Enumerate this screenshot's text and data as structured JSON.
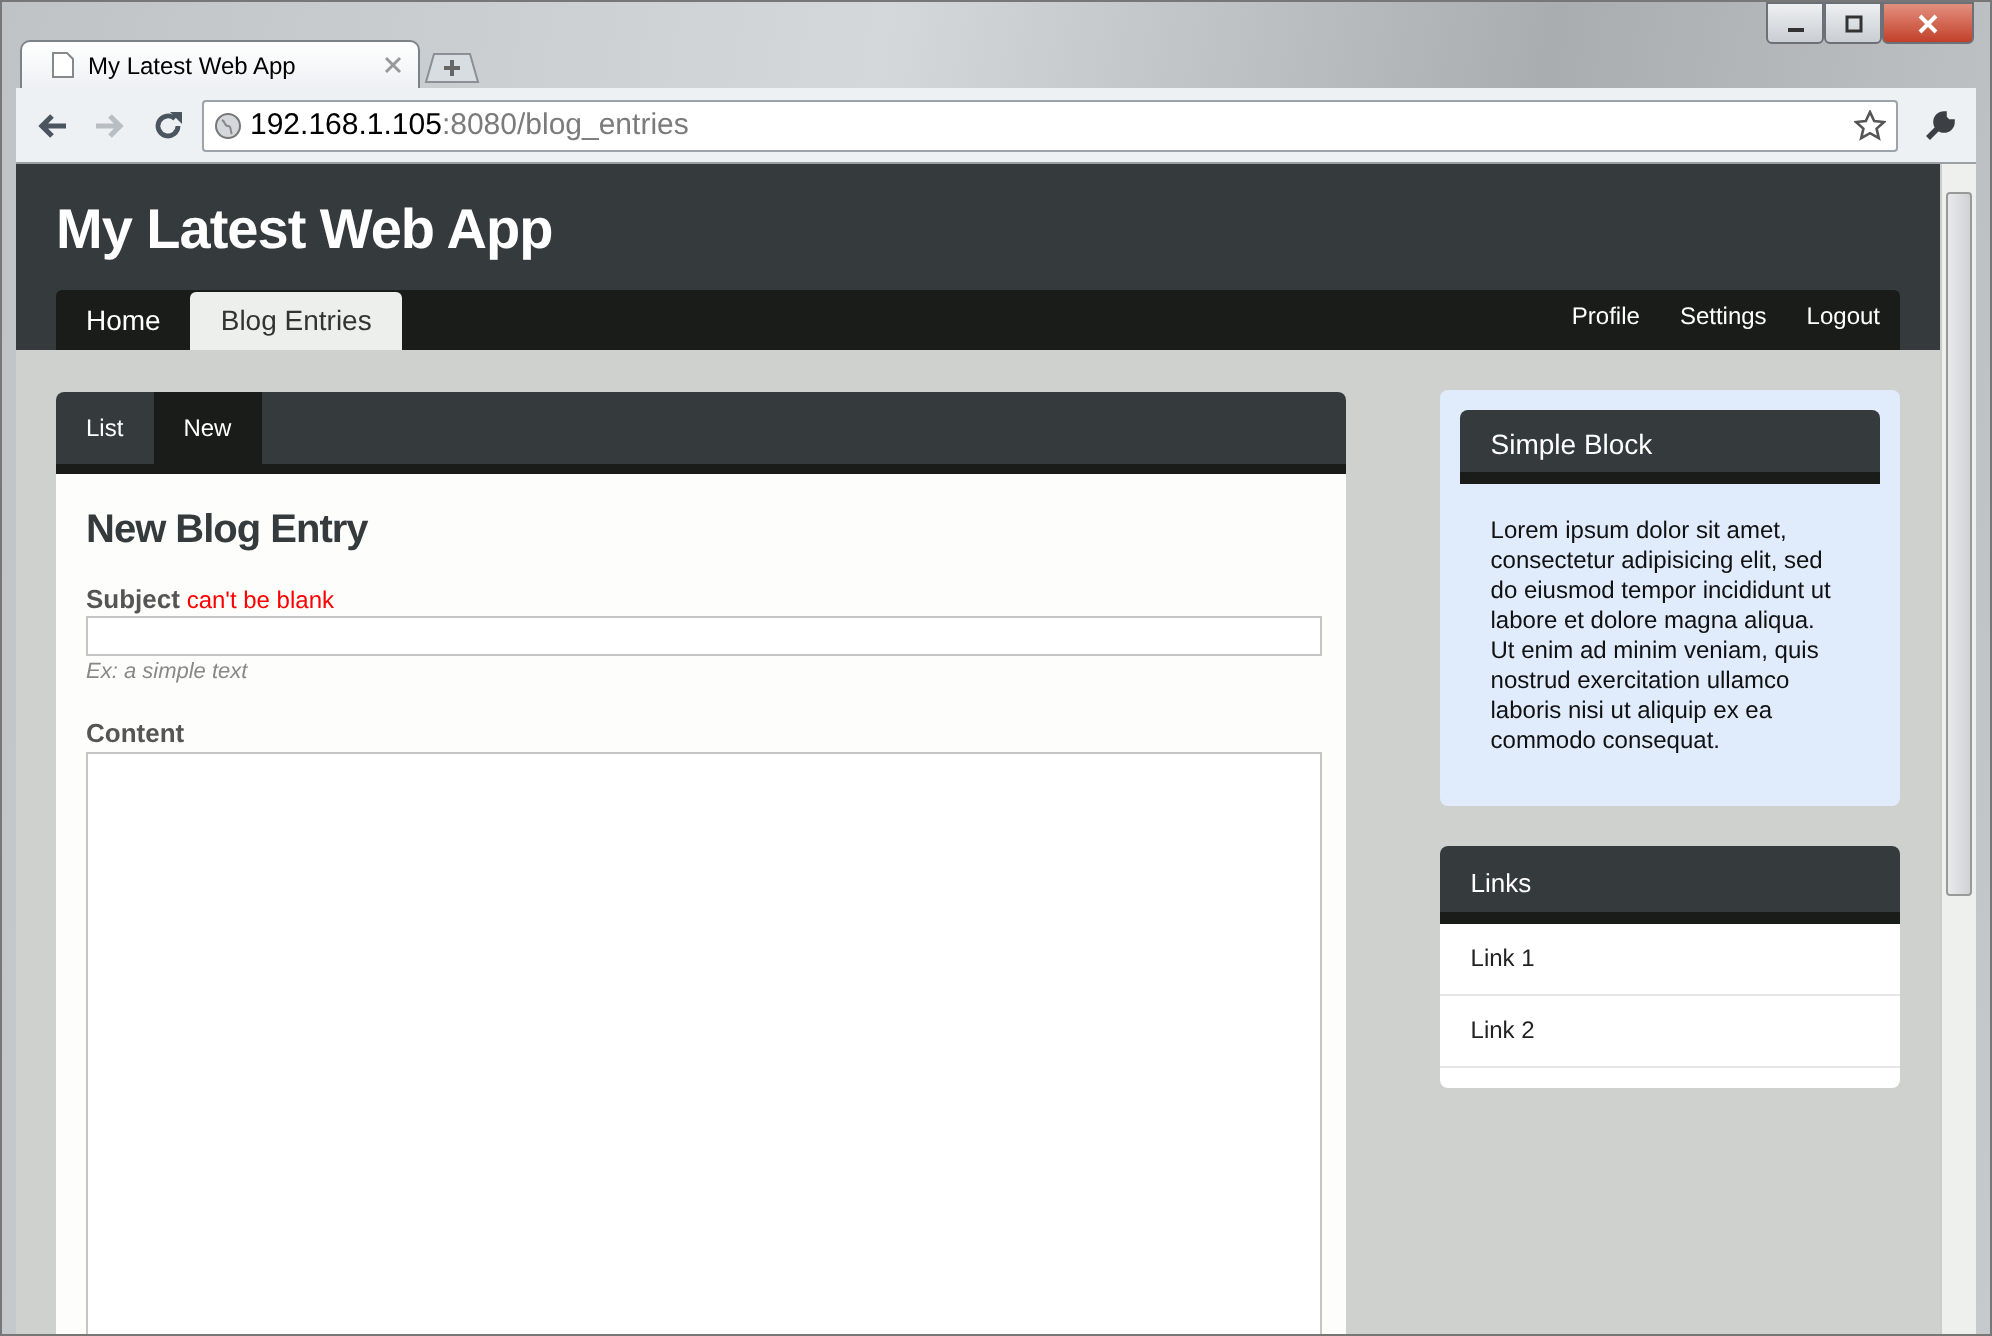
{
  "browser": {
    "tab_title": "My Latest Web App",
    "url_host": "192.168.1.105",
    "url_rest": ":8080/blog_entries"
  },
  "app": {
    "title": "My Latest Web App",
    "main_nav": [
      {
        "label": "Home",
        "selected": false
      },
      {
        "label": "Blog Entries",
        "selected": true
      }
    ],
    "user_nav": [
      "Profile",
      "Settings",
      "Logout"
    ]
  },
  "subtabs": [
    {
      "label": "List",
      "selected": false
    },
    {
      "label": "New",
      "selected": true
    }
  ],
  "form": {
    "heading": "New Blog Entry",
    "subject_label": "Subject",
    "subject_error": "can't be blank",
    "subject_hint": "Ex: a simple text",
    "content_label": "Content"
  },
  "simple_block": {
    "title": "Simple Block",
    "text": "Lorem ipsum dolor sit amet, consectetur adipisicing elit, sed do eiusmod tempor incididunt ut labore et dolore magna aliqua. Ut enim ad minim veniam, quis nostrud exercitation ullamco laboris nisi ut aliquip ex ea commodo consequat."
  },
  "links_block": {
    "title": "Links",
    "links": [
      "Link 1",
      "Link 2"
    ]
  }
}
